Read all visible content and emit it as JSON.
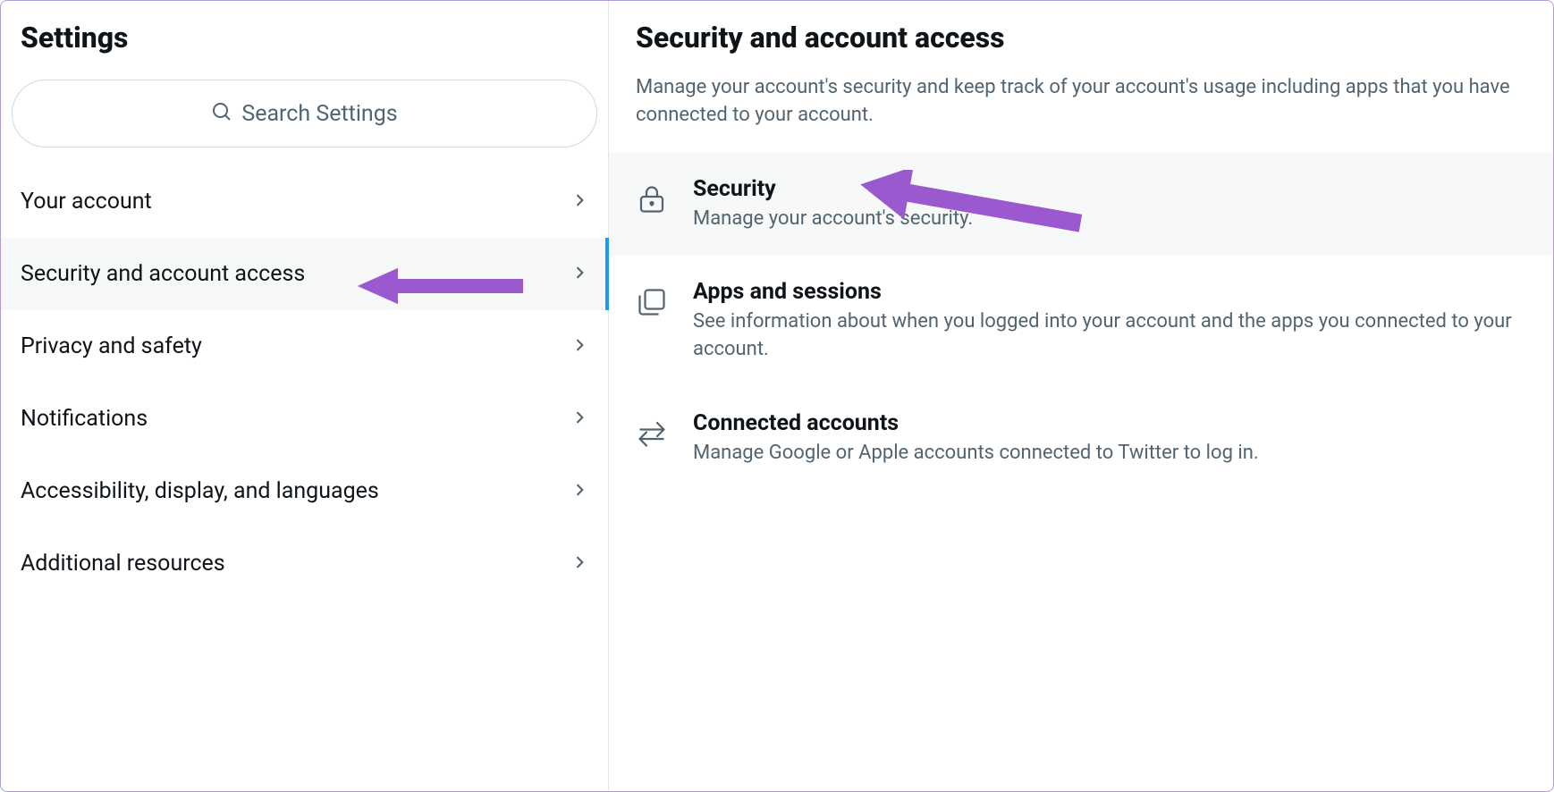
{
  "sidebar": {
    "title": "Settings",
    "search_placeholder": "Search Settings",
    "items": [
      {
        "label": "Your account"
      },
      {
        "label": "Security and account access",
        "active": true
      },
      {
        "label": "Privacy and safety"
      },
      {
        "label": "Notifications"
      },
      {
        "label": "Accessibility, display, and languages"
      },
      {
        "label": "Additional resources"
      }
    ]
  },
  "main": {
    "title": "Security and account access",
    "description": "Manage your account's security and keep track of your account's usage including apps that you have connected to your account.",
    "items": [
      {
        "title": "Security",
        "description": "Manage your account's security.",
        "highlighted": true
      },
      {
        "title": "Apps and sessions",
        "description": "See information about when you logged into your account and the apps you connected to your account."
      },
      {
        "title": "Connected accounts",
        "description": "Manage Google or Apple accounts connected to Twitter to log in."
      }
    ]
  }
}
